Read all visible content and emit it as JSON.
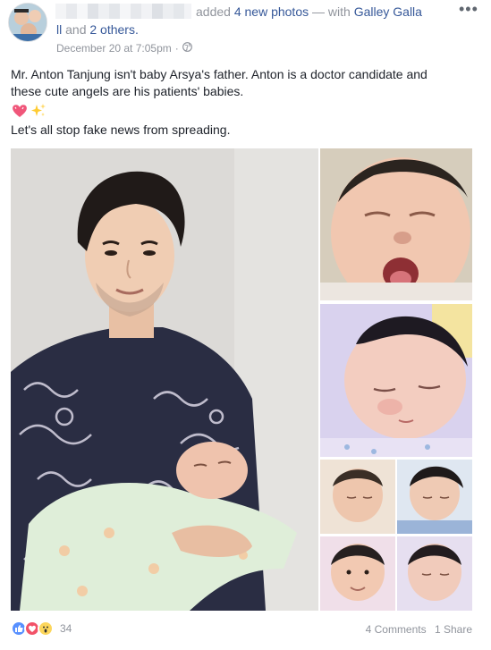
{
  "header": {
    "action_text": "added",
    "photo_count_link": "4 new photos",
    "with_text": "— with",
    "tagged_name_part1": "Galley Galla",
    "tagged_name_part2": "ll",
    "and_text": "and",
    "others_link": "2 others.",
    "timestamp": "December 20 at 7:05pm",
    "separator": "·",
    "more_glyph": "•••",
    "privacy_icon": "globe-icon"
  },
  "post": {
    "text_line1": "Mr. Anton Tanjung isn't baby Arsya's father. Anton is a doctor candidate and",
    "text_line2": "these cute angels are his patients' babies.",
    "emojis": [
      "heart-emoji",
      "sparkles-emoji"
    ],
    "text_line3": "Let's all stop fake news from spreading."
  },
  "photos": [
    {
      "name": "man-holding-baby-photo"
    },
    {
      "name": "yawning-baby-photo"
    },
    {
      "name": "sleeping-baby-photo"
    },
    {
      "name": "baby-collage-photo"
    }
  ],
  "footer": {
    "reactions": [
      "like-icon",
      "love-icon",
      "wow-icon"
    ],
    "reaction_count": "34",
    "comments": "4 Comments",
    "shares": "1 Share"
  },
  "colors": {
    "link": "#365899",
    "meta": "#90949c",
    "text": "#1d2129",
    "like": "#5890ff",
    "love": "#f25268",
    "wow": "#fcd65c"
  }
}
